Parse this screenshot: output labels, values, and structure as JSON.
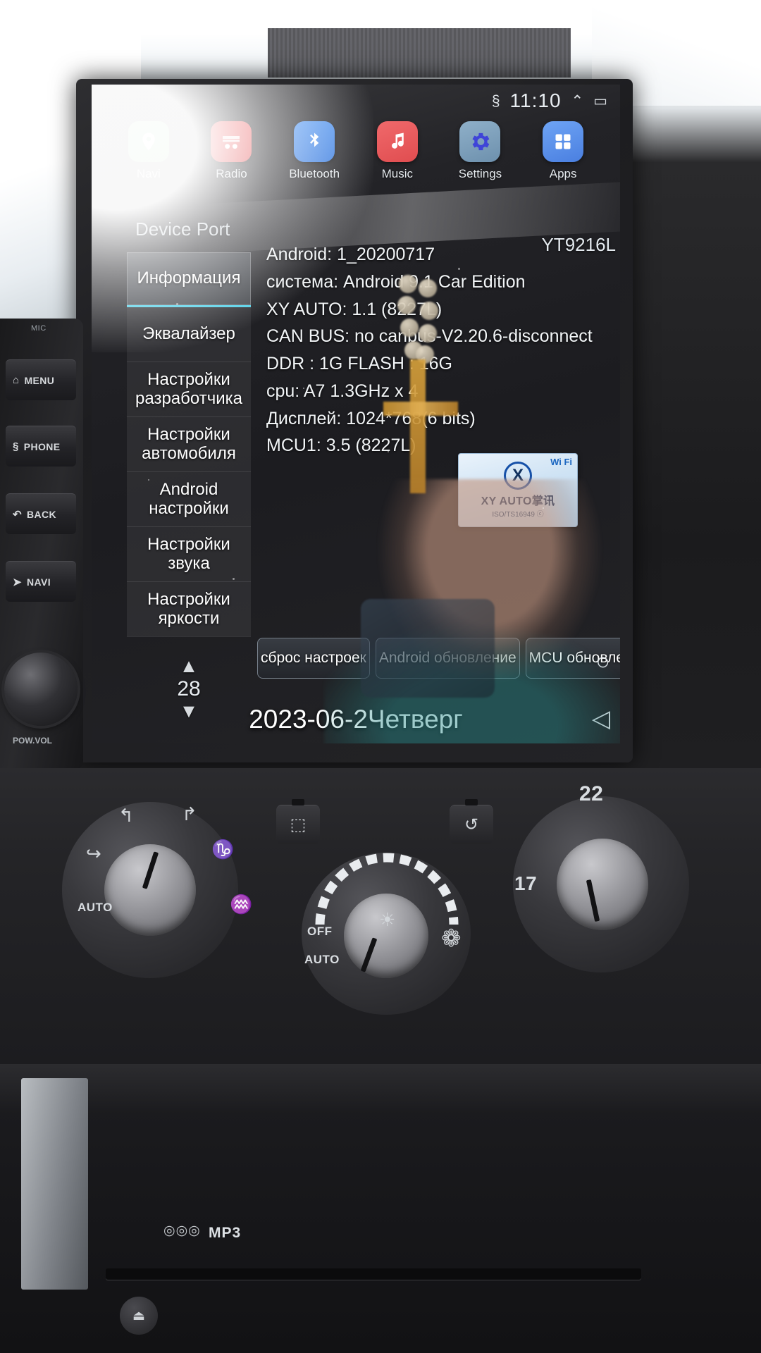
{
  "statusbar": {
    "bluetooth_icon": "bluetooth-icon",
    "time": "11:10",
    "collapse_icon": "chevron-up-icon",
    "battery_icon": "battery-icon"
  },
  "dock": {
    "items": [
      {
        "label": "Navi",
        "icon": "map-pin-icon"
      },
      {
        "label": "Radio",
        "icon": "radio-icon"
      },
      {
        "label": "Bluetooth",
        "icon": "bluetooth-icon"
      },
      {
        "label": "Music",
        "icon": "music-note-icon"
      },
      {
        "label": "Settings",
        "icon": "gear-icon"
      },
      {
        "label": "Apps",
        "icon": "grid-apps-icon"
      }
    ]
  },
  "settings": {
    "window_title": "Device Port",
    "unit_model": "YT9216L",
    "sidebar": [
      {
        "label": "Информация",
        "active": true
      },
      {
        "label": "Эквалайзер",
        "active": false
      },
      {
        "label": "Настройки разработчика",
        "active": false
      },
      {
        "label": "Настройки автомобиля",
        "active": false
      },
      {
        "label": "Android настройки",
        "active": false
      },
      {
        "label": "Настройки звука",
        "active": false
      },
      {
        "label": "Настройки яркости",
        "active": false
      }
    ],
    "spinner": {
      "up_arrow": "▲",
      "value": "28",
      "down_arrow": "▼"
    },
    "info_lines": [
      "Android:  1_20200717",
      "система: Android 9.1 Car Edition",
      "XY AUTO: 1.1 (8227L)",
      "CAN BUS: no canbus-V2.20.6-disconnect",
      "DDR : 1G    FLASH :  16G",
      "cpu: A7 1.3GHz x 4",
      "Дисплей: 1024*768(6 bits)",
      "MCU1: 3.5 (8227L)"
    ],
    "logo": {
      "wifi_text": "Wi Fi",
      "mark": "X",
      "name": "XY AUTO掌讯",
      "iso": "ISO/TS16949 ⓒ"
    },
    "buttons": [
      "сброс настроек",
      "Android обновление",
      "MCU обновление"
    ]
  },
  "overlay": {
    "date": "2023-06-2",
    "weekday": "Четверг",
    "home_icon": "circle-home-icon",
    "back_icon": "triangle-back-icon"
  },
  "left_panel": {
    "mic_label": "MIC",
    "buttons": [
      {
        "label": "MENU",
        "icon": "home-icon"
      },
      {
        "label": "PHONE",
        "icon": "bluetooth-icon"
      },
      {
        "label": "BACK",
        "icon": "return-arrow-icon"
      },
      {
        "label": "NAVI",
        "icon": "navigation-arrow-icon"
      }
    ],
    "knob_label": "POW.VOL"
  },
  "climate": {
    "mode_knob": {
      "auto_label": "AUTO",
      "icons": [
        "vent-face-icon",
        "vent-feet-icon",
        "vent-face-feet-icon",
        "defrost-windshield-icon",
        "defrost-floor-icon"
      ]
    },
    "fan_knob": {
      "off_label": "OFF",
      "auto_label": "AUTO",
      "ac_icon": "snowflake-icon",
      "fan_icon": "fan-icon"
    },
    "temp_knob": {
      "high": "22",
      "low": "17"
    },
    "rear_defrost_icon": "rear-defrost-icon",
    "recirculation_icon": "air-recirculation-icon"
  },
  "bottom": {
    "cd_logo": "disc",
    "mp3_logo": "MP3",
    "eject_icon": "eject-icon"
  }
}
